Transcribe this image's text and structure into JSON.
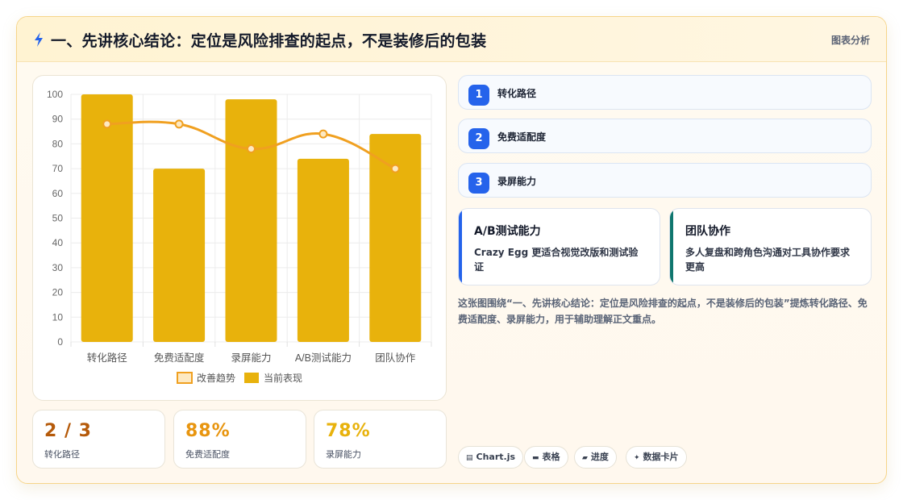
{
  "header": {
    "title": "一、先讲核心结论：定位是风险排查的起点，不是装修后的包装",
    "tag": "图表分析"
  },
  "chart_data": {
    "type": "bar",
    "categories": [
      "转化路径",
      "免费适配度",
      "录屏能力",
      "A/B测试能力",
      "团队协作"
    ],
    "series": [
      {
        "name": "当前表现",
        "type": "bar",
        "values": [
          100,
          70,
          98,
          74,
          84
        ]
      },
      {
        "name": "改善趋势",
        "type": "line",
        "values": [
          88,
          88,
          78,
          84,
          70
        ]
      }
    ],
    "ylim": [
      0,
      100
    ],
    "yticks": [
      0,
      10,
      20,
      30,
      40,
      50,
      60,
      70,
      80,
      90,
      100
    ],
    "grid": true,
    "legend": "bottom",
    "colors": {
      "bar": "#e8b20c",
      "line": "#f0a020",
      "line_fill": "#fde9c2"
    }
  },
  "stats": [
    {
      "value": "2 / 3",
      "label": "转化路径",
      "color": "#b55a0a"
    },
    {
      "value": "88%",
      "label": "免费适配度",
      "color": "#e8950f"
    },
    {
      "value": "78%",
      "label": "录屏能力",
      "color": "#e8b20c"
    }
  ],
  "steps": [
    {
      "num": "1",
      "label": "转化路径"
    },
    {
      "num": "2",
      "label": "免费适配度"
    },
    {
      "num": "3",
      "label": "录屏能力"
    }
  ],
  "cards": [
    {
      "title": "A/B测试能力",
      "desc": "Crazy Egg 更适合视觉改版和测试验证",
      "accent": "#2563eb"
    },
    {
      "title": "团队协作",
      "desc": "多人复盘和跨角色沟通对工具协作要求更高",
      "accent": "#0f766e"
    }
  ],
  "summary": "这张图围绕“一、先讲核心结论：定位是风险排查的起点，不是装修后的包装”提炼转化路径、免费适配度、录屏能力，用于辅助理解正文重点。",
  "chips": [
    {
      "icon": "chart-icon",
      "label": "Chart.js"
    },
    {
      "icon": "table-icon",
      "label": "表格"
    },
    {
      "icon": "progress-icon",
      "label": "进度"
    },
    {
      "icon": "sparkle-icon",
      "label": "数据卡片"
    }
  ]
}
